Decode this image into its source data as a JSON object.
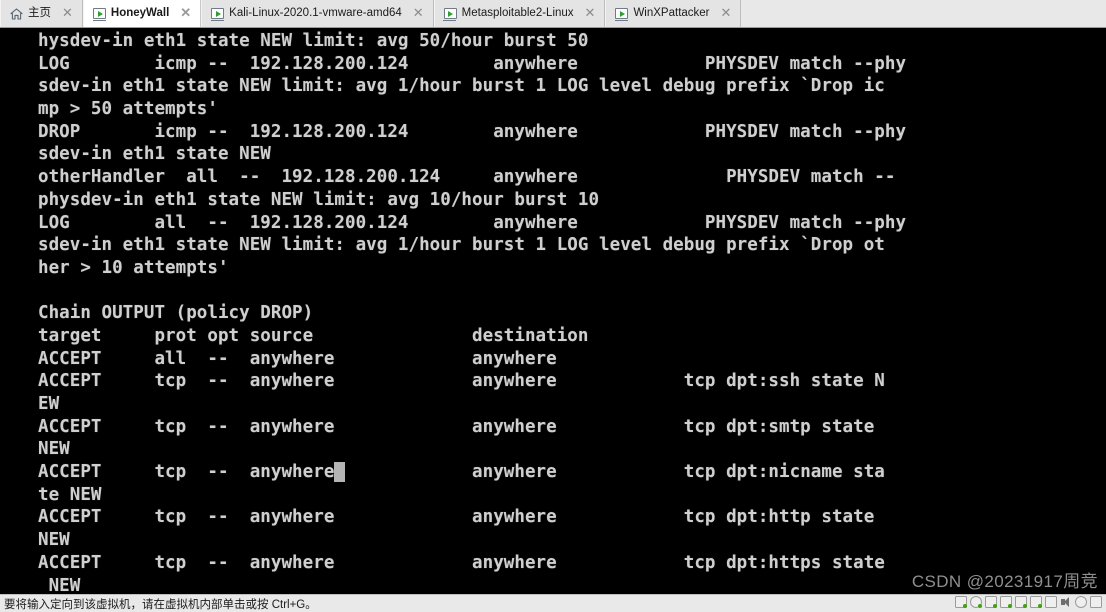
{
  "tabs": [
    {
      "label": "主页",
      "icon": "home-icon",
      "active": false,
      "closable": true
    },
    {
      "label": "HoneyWall",
      "icon": "vm-icon",
      "active": true,
      "closable": true
    },
    {
      "label": "Kali-Linux-2020.1-vmware-amd64",
      "icon": "vm-icon",
      "active": false,
      "closable": true
    },
    {
      "label": "Metasploitable2-Linux",
      "icon": "vm-icon",
      "active": false,
      "closable": true
    },
    {
      "label": "WinXPattacker",
      "icon": "vm-icon",
      "active": false,
      "closable": true
    }
  ],
  "tab_close_glyph": "✕",
  "terminal": {
    "foreground": "#cfcfcf",
    "background": "#000000",
    "cursor_color": "#b4b4b4",
    "lines": [
      "hysdev-in eth1 state NEW limit: avg 50/hour burst 50",
      "LOG        icmp --  192.128.200.124        anywhere            PHYSDEV match --phy",
      "sdev-in eth1 state NEW limit: avg 1/hour burst 1 LOG level debug prefix `Drop ic",
      "mp > 50 attempts'",
      "DROP       icmp --  192.128.200.124        anywhere            PHYSDEV match --phy",
      "sdev-in eth1 state NEW",
      "otherHandler  all  --  192.128.200.124     anywhere              PHYSDEV match --",
      "physdev-in eth1 state NEW limit: avg 10/hour burst 10",
      "LOG        all  --  192.128.200.124        anywhere            PHYSDEV match --phy",
      "sdev-in eth1 state NEW limit: avg 1/hour burst 1 LOG level debug prefix `Drop ot",
      "her > 10 attempts'",
      "",
      "Chain OUTPUT (policy DROP)",
      "target     prot opt source               destination",
      "ACCEPT     all  --  anywhere             anywhere",
      "ACCEPT     tcp  --  anywhere             anywhere            tcp dpt:ssh state N",
      "EW",
      "ACCEPT     tcp  --  anywhere             anywhere            tcp dpt:smtp state",
      "NEW",
      "ACCEPT     tcp  --  anywhere             anywhere            tcp dpt:nicname sta",
      "te NEW",
      "ACCEPT     tcp  --  anywhere             anywhere            tcp dpt:http state",
      "NEW",
      "ACCEPT     tcp  --  anywhere             anywhere            tcp dpt:https state",
      " NEW"
    ],
    "cursor": {
      "line_index": 19,
      "column_index": 28,
      "char": "e"
    }
  },
  "watermark": "CSDN @20231917周竞",
  "statusbar": {
    "hint": "要将输入定向到该虚拟机，请在虚拟机内部单击或按 Ctrl+G。",
    "tray_icons": [
      "hard-disk-icon",
      "cd-dvd-icon",
      "network-adapter-icon",
      "network-adapter-2-icon",
      "network-adapter-3-icon",
      "usb-icon",
      "printer-icon",
      "sound-icon",
      "display-icon",
      "shared-folders-icon"
    ]
  }
}
